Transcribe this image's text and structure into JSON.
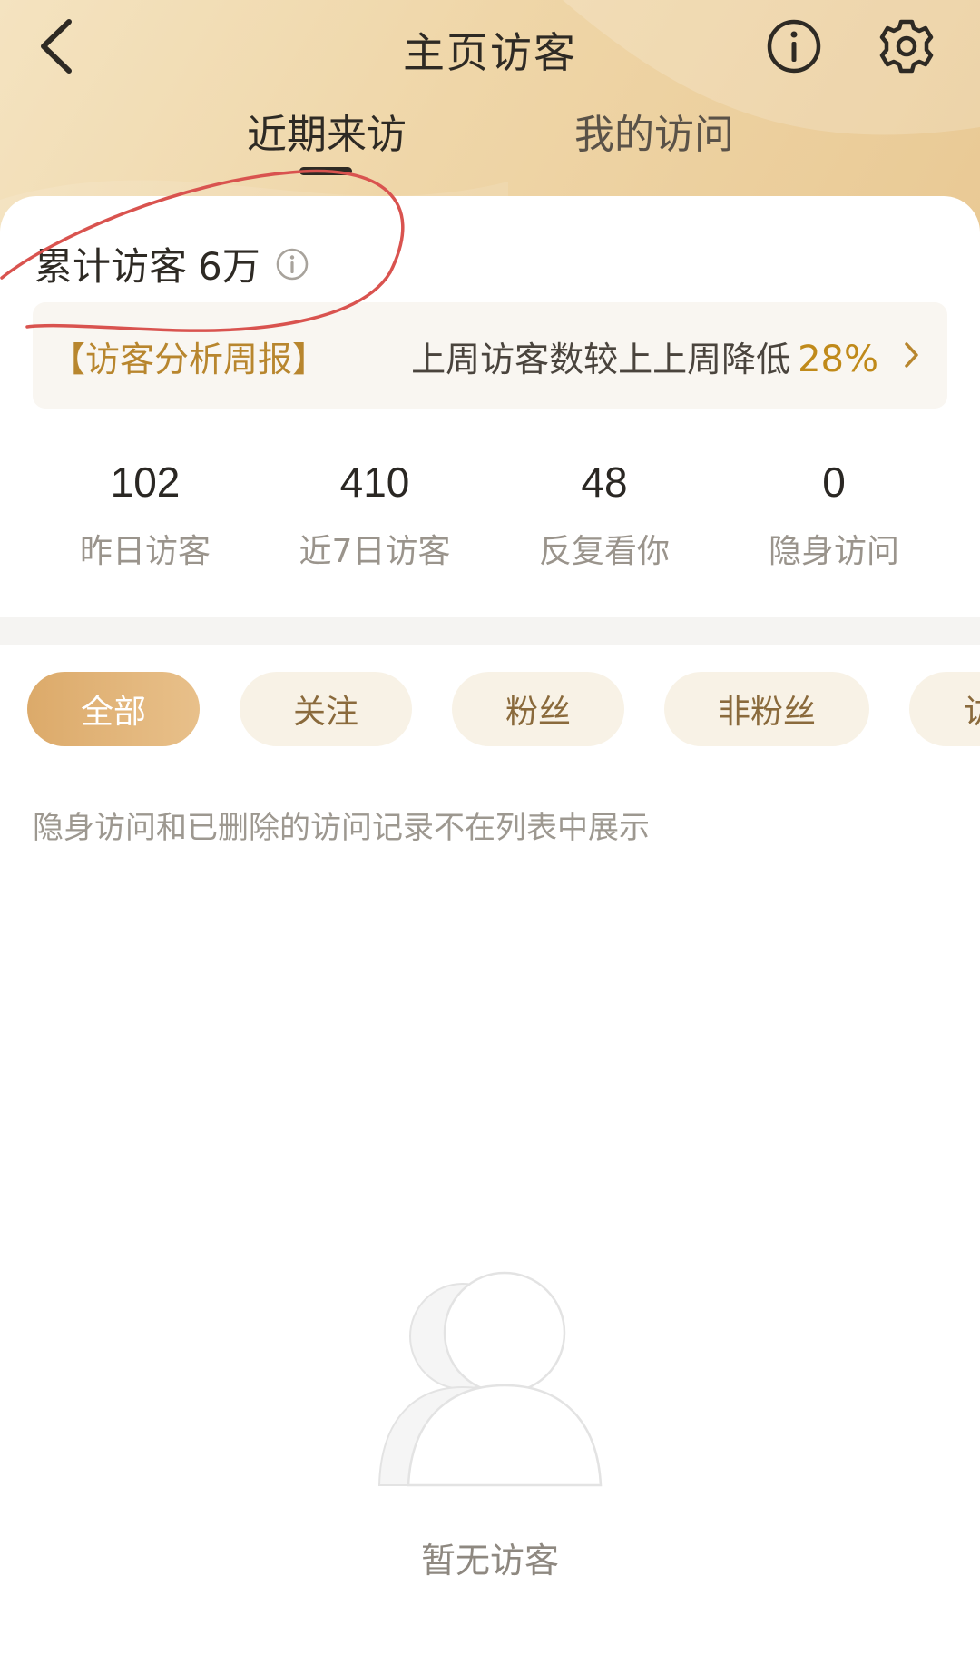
{
  "header": {
    "title": "主页访客",
    "tabs": [
      {
        "label": "近期来访",
        "active": true
      },
      {
        "label": "我的访问",
        "active": false
      }
    ]
  },
  "summary": {
    "label": "累计访客",
    "value": "6万"
  },
  "report": {
    "tag": "【访客分析周报】",
    "text": "上周访客数较上上周降低",
    "percent": "28%",
    "arrow_icon": "chevron-right-icon"
  },
  "stats": [
    {
      "value": "102",
      "label": "昨日访客"
    },
    {
      "value": "410",
      "label": "近7日访客"
    },
    {
      "value": "48",
      "label": "反复看你"
    },
    {
      "value": "0",
      "label": "隐身访问"
    }
  ],
  "filters": [
    {
      "label": "全部",
      "active": true
    },
    {
      "label": "关注",
      "active": false
    },
    {
      "label": "粉丝",
      "active": false
    },
    {
      "label": "非粉丝",
      "active": false
    },
    {
      "label": "访",
      "active": false
    }
  ],
  "notice": "隐身访问和已删除的访问记录不在列表中展示",
  "empty": {
    "text": "暂无访客",
    "icon": "users-placeholder-icon"
  },
  "colors": {
    "header_gradient_start": "#f4e3c0",
    "header_gradient_end": "#e9c994",
    "accent_gold": "#c08a1a",
    "chip_active_start": "#dcaa6a",
    "chip_bg": "#f8f2e6",
    "annotation_red": "#d9534f"
  }
}
